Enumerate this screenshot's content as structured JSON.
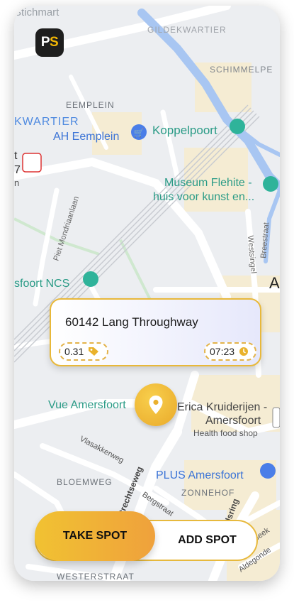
{
  "app": {
    "logo_p": "P",
    "logo_s": "S"
  },
  "map": {
    "labels": {
      "top_left": "Stichmart",
      "gildekwartier": "GILDEKWARTIER",
      "schimmelpe": "SCHIMMELPE",
      "eemplein": "EEMPLEIN",
      "kwartier": "KWARTIER",
      "ah_eemplein": "AH Eemplein",
      "koppelpoort": "Koppelpoort",
      "museum_1": "Museum Flehite -",
      "museum_2": "huis voor kunst en...",
      "piet": "Piet Mondriaanlaan",
      "breestraat": "Breestraat",
      "westsingel": "Westsingel",
      "a_big": "A",
      "left_t": "t",
      "left_7": "7",
      "left_n": "n",
      "amersfoort_ncs": "sfoort NCS",
      "vue": "Vue Amersfoort",
      "erica_1": "Erica Kruiderijen -",
      "erica_2": "Amersfoort",
      "health": "Health food shop",
      "vlasakkerweg": "Vlasakkerweg",
      "bloemweg": "BLOEMWEG",
      "plus": "PLUS Amersfoort",
      "zonnehof": "ZONNEHOF",
      "utrechtseweg": "Utrechtseweg",
      "bergstraat": "Bergstraat",
      "stadsring": "Stadsring",
      "beek": "e Beek",
      "aldegonde": "Aldegonde",
      "westerstraat": "WESTERSTRAAT"
    }
  },
  "spot_card": {
    "address": "60142 Lang Throughway",
    "price": "0.31",
    "time": "07:23"
  },
  "actions": {
    "take_spot": "TAKE SPOT",
    "add_spot": "ADD SPOT"
  }
}
